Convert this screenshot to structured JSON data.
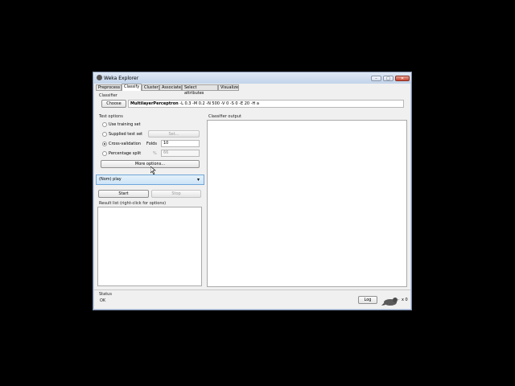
{
  "window": {
    "title": "Weka Explorer",
    "controls": {
      "minimize": "–",
      "maximize": "□",
      "close": "✕"
    }
  },
  "tabs": [
    {
      "label": "Preprocess"
    },
    {
      "label": "Classify"
    },
    {
      "label": "Cluster"
    },
    {
      "label": "Associate"
    },
    {
      "label": "Select attributes"
    },
    {
      "label": "Visualize"
    }
  ],
  "classifier": {
    "group_label": "Classifier",
    "choose_label": "Choose",
    "name": "MultilayerPerceptron",
    "options": " -L 0.3 -M 0.2 -N 500 -V 0 -S 0 -E 20 -H a"
  },
  "test_options": {
    "group_label": "Test options",
    "use_training": "Use training set",
    "supplied_test": "Supplied test set",
    "set_label": "Set...",
    "cross_validation": "Cross-validation",
    "folds_label": "Folds",
    "folds_value": "10",
    "percentage_split": "Percentage split",
    "percent_sign": "%",
    "percent_value": "66",
    "more_options": "More options..."
  },
  "class_select": {
    "value": "(Nom) play"
  },
  "actions": {
    "start": "Start",
    "stop": "Stop"
  },
  "result_list": {
    "label": "Result list (right-click for options)"
  },
  "output": {
    "label": "Classifier output"
  },
  "status": {
    "label": "Status",
    "value": "OK",
    "log_label": "Log",
    "count": "x 0"
  },
  "icons": {
    "arrow_down": "▾",
    "cursor": "mouse-cursor-icon",
    "bird": "weka-bird-icon"
  }
}
